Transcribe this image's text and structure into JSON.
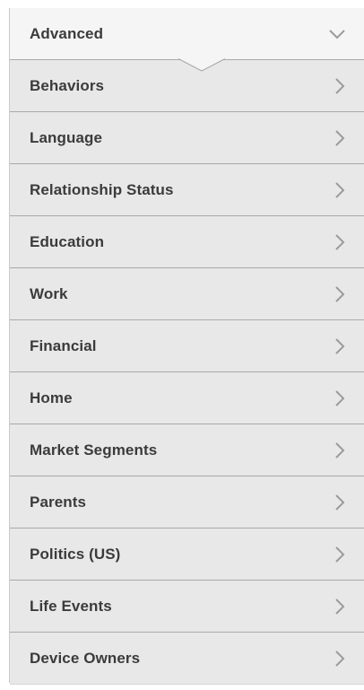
{
  "menu": {
    "header": {
      "label": "Advanced",
      "icon": "chevron-down-icon"
    },
    "items": [
      {
        "label": "Behaviors",
        "icon": "chevron-right-icon"
      },
      {
        "label": "Language",
        "icon": "chevron-right-icon"
      },
      {
        "label": "Relationship Status",
        "icon": "chevron-right-icon"
      },
      {
        "label": "Education",
        "icon": "chevron-right-icon"
      },
      {
        "label": "Work",
        "icon": "chevron-right-icon"
      },
      {
        "label": "Financial",
        "icon": "chevron-right-icon"
      },
      {
        "label": "Home",
        "icon": "chevron-right-icon"
      },
      {
        "label": "Market Segments",
        "icon": "chevron-right-icon"
      },
      {
        "label": "Parents",
        "icon": "chevron-right-icon"
      },
      {
        "label": "Politics (US)",
        "icon": "chevron-right-icon"
      },
      {
        "label": "Life Events",
        "icon": "chevron-right-icon"
      },
      {
        "label": "Device Owners",
        "icon": "chevron-right-icon"
      }
    ]
  },
  "colors": {
    "item_background": "#e8e8e8",
    "header_background": "#f5f5f5",
    "divider": "#a9a9a9",
    "text": "#3b3b3b",
    "chevron": "#9a9a9a"
  }
}
